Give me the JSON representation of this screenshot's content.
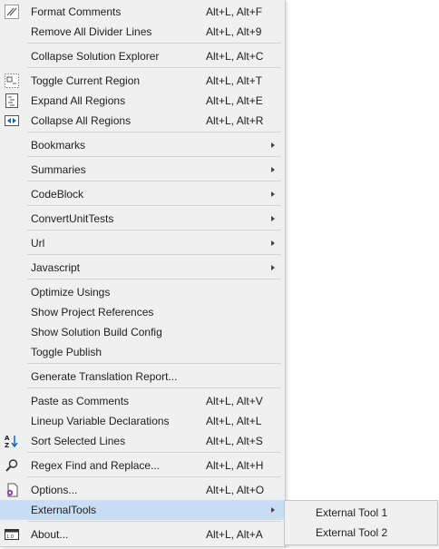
{
  "menu": {
    "format_comments": {
      "label": "Format Comments",
      "shortcut": "Alt+L, Alt+F"
    },
    "remove_dividers": {
      "label": "Remove All Divider Lines",
      "shortcut": "Alt+L, Alt+9"
    },
    "collapse_solution": {
      "label": "Collapse Solution Explorer",
      "shortcut": "Alt+L, Alt+C"
    },
    "toggle_region": {
      "label": "Toggle Current Region",
      "shortcut": "Alt+L, Alt+T"
    },
    "expand_regions": {
      "label": "Expand All Regions",
      "shortcut": "Alt+L, Alt+E"
    },
    "collapse_regions": {
      "label": "Collapse All Regions",
      "shortcut": "Alt+L, Alt+R"
    },
    "bookmarks": {
      "label": "Bookmarks"
    },
    "summaries": {
      "label": "Summaries"
    },
    "codeblock": {
      "label": "CodeBlock"
    },
    "convert_unit_tests": {
      "label": "ConvertUnitTests"
    },
    "url": {
      "label": "Url"
    },
    "javascript": {
      "label": "Javascript"
    },
    "optimize_usings": {
      "label": "Optimize Usings"
    },
    "show_project_refs": {
      "label": "Show Project References"
    },
    "show_build_config": {
      "label": "Show Solution Build Config"
    },
    "toggle_publish": {
      "label": "Toggle Publish"
    },
    "translation_report": {
      "label": "Generate Translation Report..."
    },
    "paste_comments": {
      "label": "Paste as Comments",
      "shortcut": "Alt+L, Alt+V"
    },
    "lineup_vars": {
      "label": "Lineup Variable Declarations",
      "shortcut": "Alt+L, Alt+L"
    },
    "sort_lines": {
      "label": "Sort Selected Lines",
      "shortcut": "Alt+L, Alt+S"
    },
    "regex_replace": {
      "label": "Regex Find and Replace...",
      "shortcut": "Alt+L, Alt+H"
    },
    "options": {
      "label": "Options...",
      "shortcut": "Alt+L, Alt+O"
    },
    "external_tools": {
      "label": "ExternalTools"
    },
    "about": {
      "label": "About...",
      "shortcut": "Alt+L, Alt+A"
    }
  },
  "submenu": {
    "tool1": "External Tool 1",
    "tool2": "External Tool 2"
  },
  "icons": {
    "format_comments": "pencil-lines-icon",
    "toggle_region": "dotted-region-icon",
    "expand_regions": "expand-regions-icon",
    "collapse_regions": "collapse-regions-icon",
    "sort_lines": "sort-az-icon",
    "regex_replace": "magnifier-icon",
    "options": "gear-page-icon",
    "about": "version-box-icon"
  },
  "colors": {
    "menu_bg": "#f0f0f0",
    "highlight": "#c9def5",
    "separator": "#d4d4d4",
    "text": "#1e1e1e",
    "icon_blue": "#1565c0"
  }
}
